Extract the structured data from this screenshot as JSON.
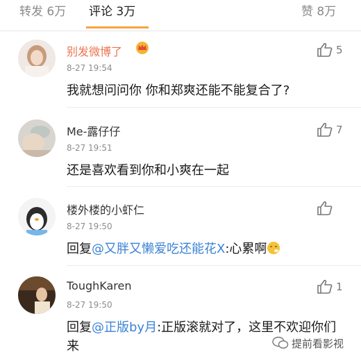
{
  "tabs": {
    "repost": "转发 6万",
    "comment": "评论 3万",
    "like": "赞 8万"
  },
  "comments": [
    {
      "name": "别发微博了",
      "time": "8-27 19:54",
      "text": "我就想问问你 你和郑爽还能不能复合了?",
      "likes": "5"
    },
    {
      "name": "Me-露仔仔",
      "time": "8-27 19:51",
      "text": "还是喜欢看到你和小爽在一起",
      "likes": "7"
    },
    {
      "name": "楼外楼的小虾仁",
      "time": "8-27 19:50",
      "reply_prefix": "回复",
      "mention": "@又胖又懒爱吃还能花X",
      "text": ":心累啊",
      "likes": ""
    },
    {
      "name": "ToughKaren",
      "time": "8-27 19:50",
      "reply_prefix": "回复",
      "mention": "@正版by月",
      "text": ":正版滚就对了，这里不欢迎你们来",
      "likes": "1"
    }
  ],
  "watermark": "提前看影视",
  "colors": {
    "accent": "#f7a33b",
    "vip_name": "#eb7350",
    "mention": "#3b83d6"
  }
}
